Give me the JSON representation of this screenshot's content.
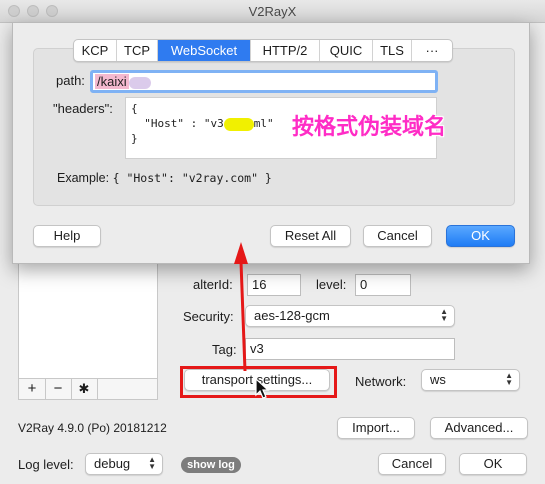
{
  "window": {
    "title": "V2RayX"
  },
  "sheet": {
    "tabs": [
      "KCP",
      "TCP",
      "WebSocket",
      "HTTP/2",
      "QUIC",
      "TLS",
      "···"
    ],
    "active_tab": "WebSocket",
    "path_label": "path:",
    "path_value": "/kaixi",
    "headers_label": "\"headers\":",
    "headers_lines": [
      "{",
      "  \"Host\" : \"v3",
      "ml\"",
      "}"
    ],
    "example_label": "Example:",
    "example_value": "{ \"Host\": \"v2ray.com\" }",
    "help_button": "Help",
    "reset_button": "Reset All",
    "cancel_button": "Cancel",
    "ok_button": "OK"
  },
  "annotation": {
    "text": "按格式伪装域名",
    "color": "#ff2cc6",
    "arrow_color": "#e51818"
  },
  "server": {
    "alterid_label": "alterId:",
    "alterid_value": "16",
    "level_label": "level:",
    "level_value": "0",
    "security_label": "Security:",
    "security_value": "aes-128-gcm",
    "tag_label": "Tag:",
    "tag_value": "v3",
    "transport_button": "transport settings...",
    "network_label": "Network:",
    "network_value": "ws"
  },
  "list_toolbar": {
    "add": "+",
    "remove": "−",
    "gear": "✱"
  },
  "footer": {
    "version": "V2Ray 4.9.0 (Po) 20181212",
    "import_button": "Import...",
    "advanced_button": "Advanced...",
    "loglevel_label": "Log level:",
    "loglevel_value": "debug",
    "showlog_button": "show log",
    "cancel_button": "Cancel",
    "ok_button": "OK"
  },
  "colors": {
    "accent": "#2f7bf0",
    "highlight_box": "#e51818"
  }
}
